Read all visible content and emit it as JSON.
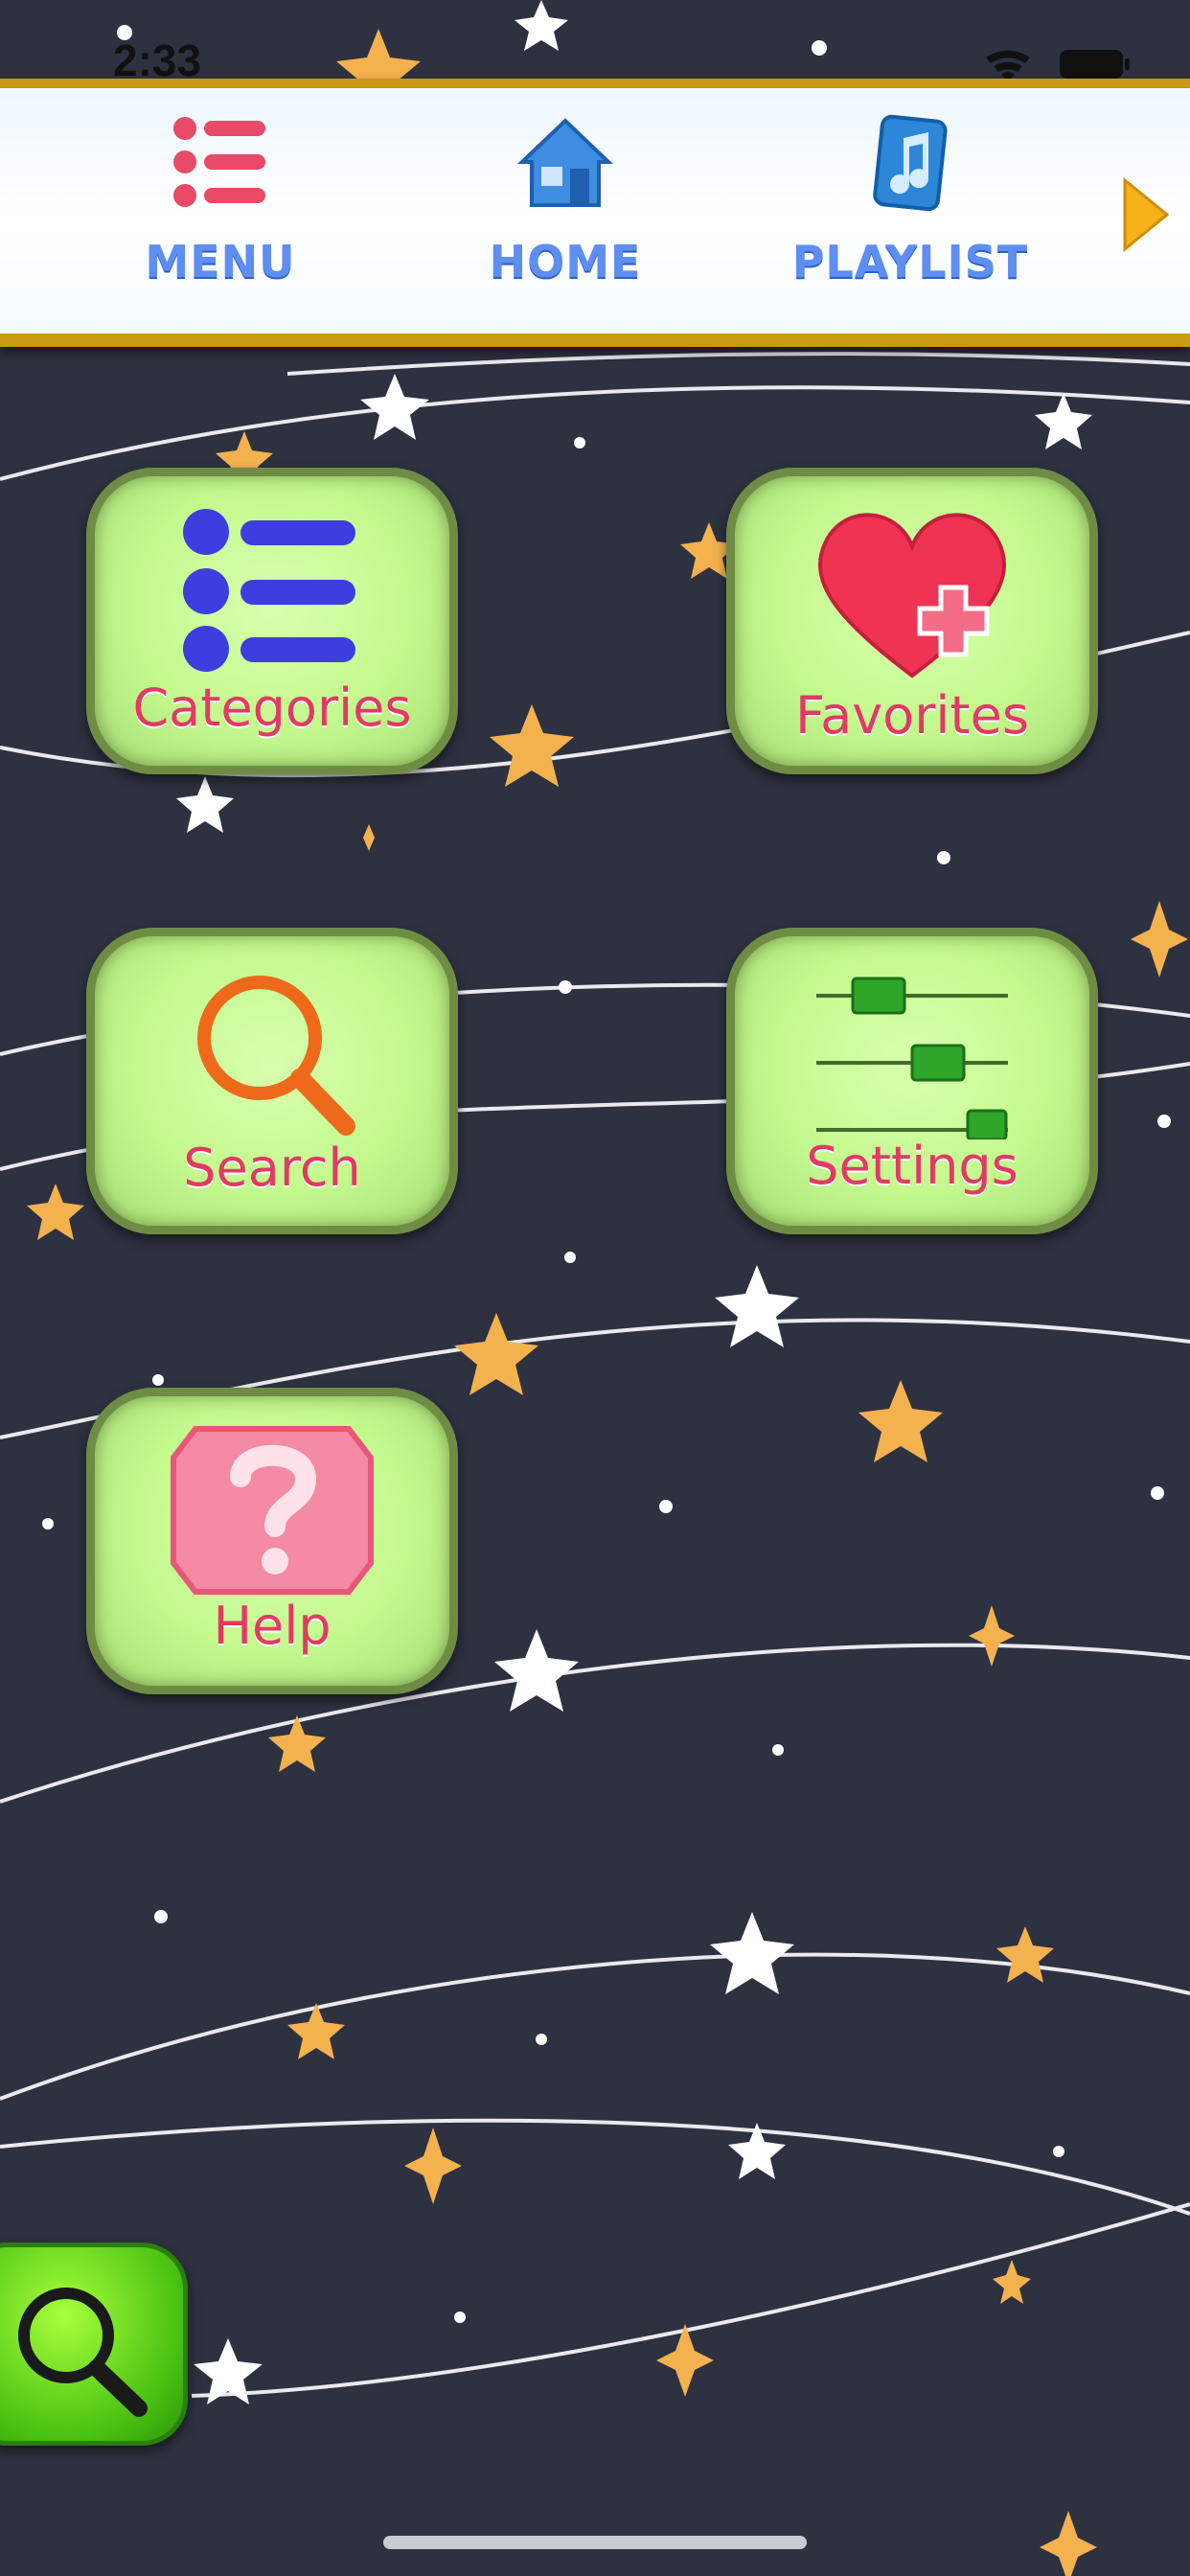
{
  "status_bar": {
    "time": "2:33"
  },
  "navbar": {
    "items": [
      {
        "label": "MENU",
        "icon": "list-icon"
      },
      {
        "label": "HOME",
        "icon": "house-icon"
      },
      {
        "label": "PLAYLIST",
        "icon": "music-note-icon"
      }
    ],
    "more_icon": "next-arrow-icon"
  },
  "tiles": [
    {
      "label": "Categories",
      "icon": "categories-list-icon"
    },
    {
      "label": "Favorites",
      "icon": "heart-plus-icon"
    },
    {
      "label": "Search",
      "icon": "magnifier-icon"
    },
    {
      "label": "Settings",
      "icon": "sliders-icon"
    },
    {
      "label": "Help",
      "icon": "question-mark-icon"
    }
  ],
  "floating_button": {
    "icon": "search-icon"
  },
  "colors": {
    "background": "#2e3140",
    "navbar_border": "#c99a12",
    "nav_label": "#5e8ef2",
    "tile_fill": "#c4f98e",
    "tile_label": "#e23a62",
    "fab": "#48c010"
  }
}
